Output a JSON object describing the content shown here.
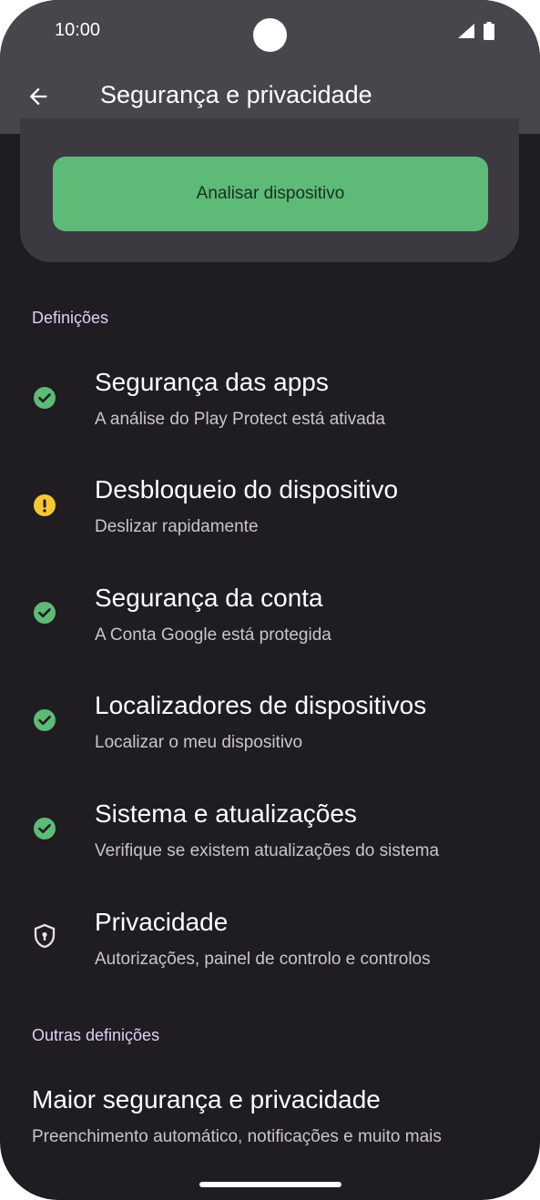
{
  "status_bar": {
    "time": "10:00"
  },
  "app_bar": {
    "title": "Segurança e privacidade"
  },
  "scan_card": {
    "button_label": "Analisar dispositivo"
  },
  "sections": [
    {
      "header": "Definições"
    },
    {
      "header": "Outras definições"
    }
  ],
  "items": [
    {
      "title": "Segurança das apps",
      "subtitle": "A análise do Play Protect está ativada",
      "icon": "check-circle-icon",
      "status": "ok"
    },
    {
      "title": "Desbloqueio do dispositivo",
      "subtitle": "Deslizar rapidamente",
      "icon": "warning-circle-icon",
      "status": "warning"
    },
    {
      "title": "Segurança da conta",
      "subtitle": "A Conta Google está protegida",
      "icon": "check-circle-icon",
      "status": "ok"
    },
    {
      "title": "Localizadores de dispositivos",
      "subtitle": "Localizar o meu dispositivo",
      "icon": "check-circle-icon",
      "status": "ok"
    },
    {
      "title": "Sistema e atualizações",
      "subtitle": "Verifique se existem atualizações do sistema",
      "icon": "check-circle-icon",
      "status": "ok"
    },
    {
      "title": "Privacidade",
      "subtitle": "Autorizações, painel de controlo e controlos",
      "icon": "privacy-shield-icon",
      "status": "neutral"
    },
    {
      "title": "Maior segurança e privacidade",
      "subtitle": "Preenchimento automático, notificações e muito mais"
    }
  ],
  "colors": {
    "background": "#1f1c22",
    "app_bar": "#48464c",
    "card": "#3c3a40",
    "accent_green": "#5dba77",
    "warning_yellow": "#f6c731",
    "section_header": "#e0cef5"
  }
}
